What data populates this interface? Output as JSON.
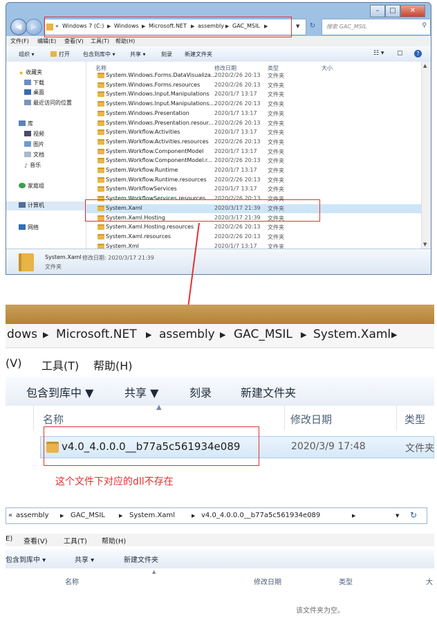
{
  "window1": {
    "address_crumbs": [
      "Windows 7 (C:)",
      "Windows",
      "Microsoft.NET",
      "assembly",
      "GAC_MSIL"
    ],
    "address_prefix": "«",
    "search_placeholder": "搜索 GAC_MSIL",
    "menu": [
      "文件(F)",
      "编辑(E)",
      "查看(V)",
      "工具(T)",
      "帮助(H)"
    ],
    "toolbar": [
      "组织 ▾",
      "打开",
      "包含到库中 ▾",
      "共享 ▾",
      "刻录",
      "新建文件夹"
    ],
    "columns": [
      "名称",
      "修改日期",
      "类型",
      "大小"
    ],
    "nav": {
      "favorites": "收藏夹",
      "fav_items": [
        "下载",
        "桌面",
        "最近访问的位置"
      ],
      "libraries": "库",
      "lib_items": [
        "视频",
        "图片",
        "文档",
        "音乐"
      ],
      "homegroup": "家庭组",
      "computer": "计算机",
      "network": "网络"
    },
    "rows": [
      {
        "name": "System.Windows.Forms.DataVisualiza...",
        "date": "2020/2/26 20:13",
        "type": "文件夹"
      },
      {
        "name": "System.Windows.Forms.resources",
        "date": "2020/2/26 20:13",
        "type": "文件夹"
      },
      {
        "name": "System.Windows.Input.Manipulations",
        "date": "2020/1/7 13:17",
        "type": "文件夹"
      },
      {
        "name": "System.Windows.Input.Manipulations....",
        "date": "2020/2/26 20:13",
        "type": "文件夹"
      },
      {
        "name": "System.Windows.Presentation",
        "date": "2020/1/7 13:17",
        "type": "文件夹"
      },
      {
        "name": "System.Windows.Presentation.resour...",
        "date": "2020/2/26 20:13",
        "type": "文件夹"
      },
      {
        "name": "System.Workflow.Activities",
        "date": "2020/1/7 13:17",
        "type": "文件夹"
      },
      {
        "name": "System.Workflow.Activities.resources",
        "date": "2020/2/26 20:13",
        "type": "文件夹"
      },
      {
        "name": "System.Workflow.ComponentModel",
        "date": "2020/1/7 13:17",
        "type": "文件夹"
      },
      {
        "name": "System.Workflow.ComponentModel.r...",
        "date": "2020/2/26 20:13",
        "type": "文件夹"
      },
      {
        "name": "System.Workflow.Runtime",
        "date": "2020/1/7 13:17",
        "type": "文件夹"
      },
      {
        "name": "System.Workflow.Runtime.resources",
        "date": "2020/2/26 20:13",
        "type": "文件夹"
      },
      {
        "name": "System.WorkflowServices",
        "date": "2020/1/7 13:17",
        "type": "文件夹"
      },
      {
        "name": "System.WorkflowServices.resources",
        "date": "2020/2/26 20:13",
        "type": "文件夹"
      },
      {
        "name": "System.Xaml",
        "date": "2020/3/17 21:39",
        "type": "文件夹",
        "selected": true
      },
      {
        "name": "System.Xaml.Hosting",
        "date": "2020/3/17 21:39",
        "type": "文件夹"
      },
      {
        "name": "System.Xaml.Hosting.resources",
        "date": "2020/2/26 20:13",
        "type": "文件夹"
      },
      {
        "name": "System.Xaml.resources",
        "date": "2020/2/26 20:13",
        "type": "文件夹"
      },
      {
        "name": "System.Xml",
        "date": "2020/1/7 13:17",
        "type": "文件夹"
      }
    ],
    "details": {
      "name": "System.Xaml",
      "modified": "修改日期: 2020/3/17 21:39",
      "kind": "文件夹"
    }
  },
  "zoom2": {
    "crumbs": [
      "dows",
      "Microsoft.NET",
      "assembly",
      "GAC_MSIL",
      "System.Xaml"
    ],
    "menu": [
      "(V)",
      "工具(T)",
      "帮助(H)"
    ],
    "toolbar": [
      "包含到库中 ▼",
      "共享 ▼",
      "刻录",
      "新建文件夹"
    ],
    "columns": [
      "名称",
      "修改日期",
      "类型"
    ],
    "row": {
      "name": "v4.0_4.0.0.0__b77a5c561934e089",
      "date": "2020/3/9 17:48",
      "type": "文件夹"
    },
    "note": "这个文件下对应的dll不存在"
  },
  "window3": {
    "crumbs": [
      "assembly",
      "GAC_MSIL",
      "System.Xaml",
      "v4.0_4.0.0.0__b77a5c561934e089"
    ],
    "address_prefix": "«",
    "menu": [
      "E)",
      "查看(V)",
      "工具(T)",
      "帮助(H)"
    ],
    "toolbar": [
      "包含到库中 ▾",
      "共享 ▾",
      "新建文件夹"
    ],
    "columns": [
      "名称",
      "修改日期",
      "类型",
      "大"
    ],
    "empty_text": "该文件夹为空。"
  },
  "colors": {
    "highlight": "#e53030",
    "selection": "#cde6f7",
    "folder": "#e8b445"
  }
}
